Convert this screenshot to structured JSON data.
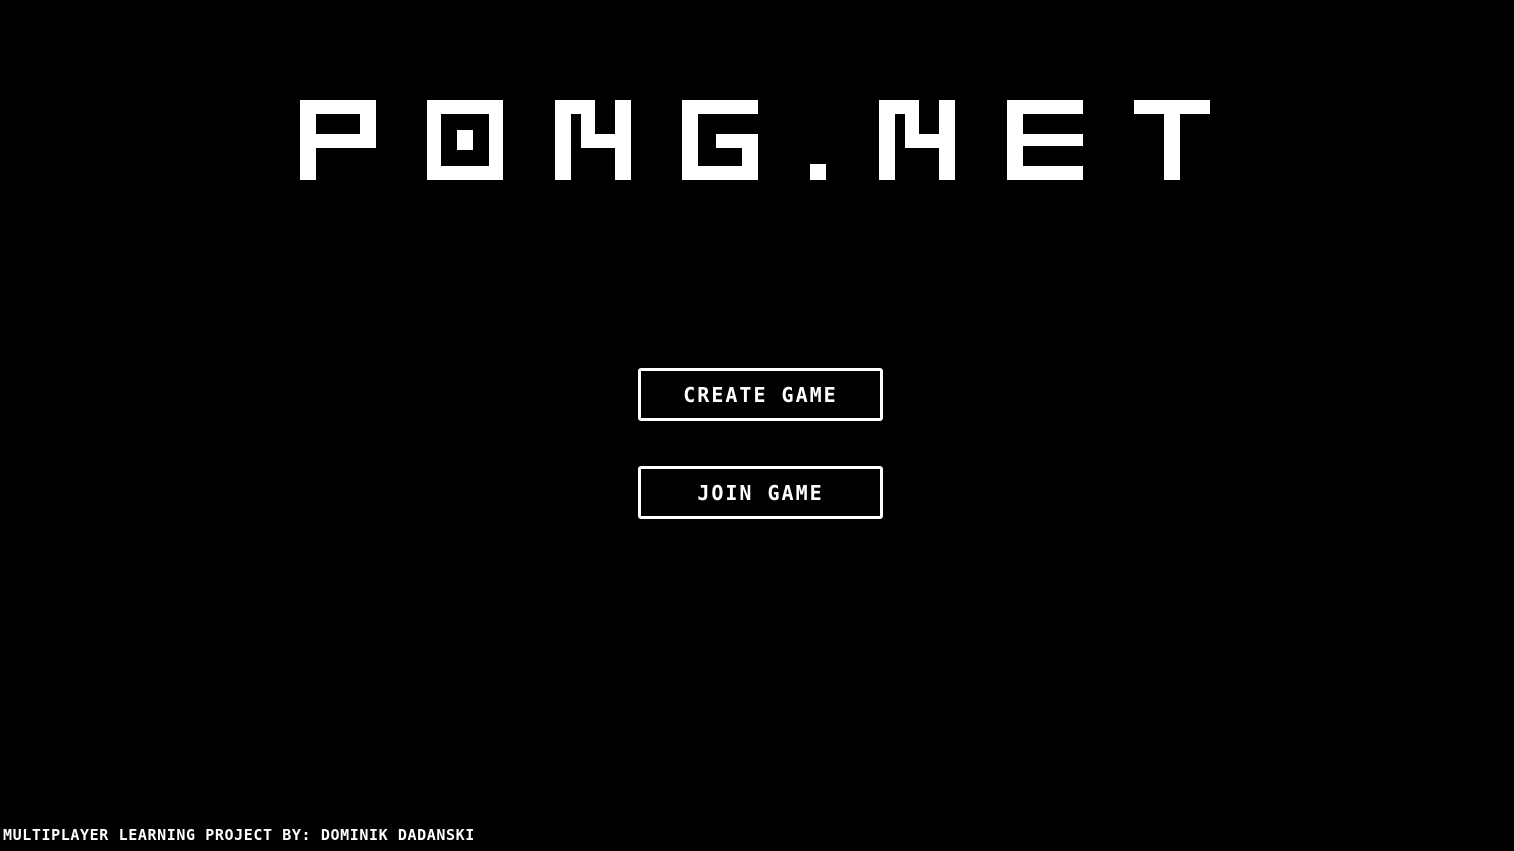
{
  "game": {
    "title": "PONG.NET",
    "menu": {
      "create_label": "CREATE GAME",
      "join_label": "JOIN GAME"
    },
    "footer_text": "MULTIPLAYER LEARNING PROJECT BY: DOMINIK DADANSKI"
  },
  "colors": {
    "background": "#000000",
    "foreground": "#ffffff"
  }
}
